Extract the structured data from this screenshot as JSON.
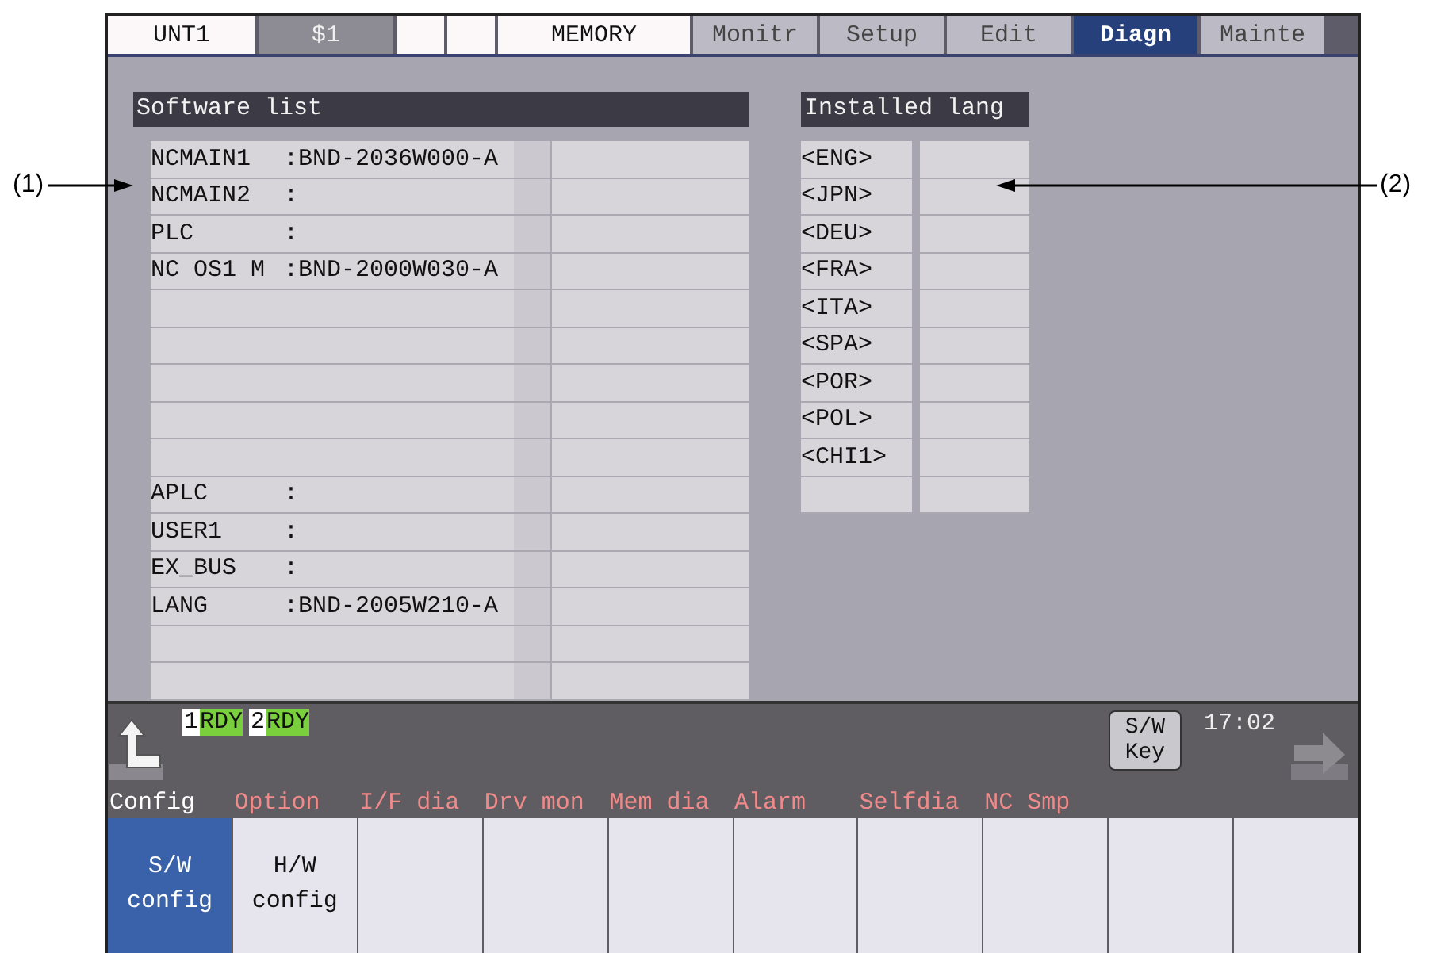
{
  "top_bar": {
    "fields": [
      {
        "kind": "unit",
        "label": "UNT1"
      },
      {
        "kind": "system",
        "label": "$1"
      },
      {
        "kind": "blank"
      },
      {
        "kind": "blank"
      },
      {
        "kind": "mode",
        "label": "MEMORY"
      }
    ],
    "tabs": [
      {
        "label": "Monitr",
        "selected": false
      },
      {
        "label": "Setup",
        "selected": false
      },
      {
        "label": "Edit",
        "selected": false
      },
      {
        "label": "Diagn",
        "selected": true
      },
      {
        "label": "Mainte",
        "selected": false
      }
    ]
  },
  "software_list": {
    "title": "Software list",
    "rows": [
      {
        "name": "NCMAIN1",
        "value": ":BND-2036W000-A"
      },
      {
        "name": "NCMAIN2",
        "value": ":"
      },
      {
        "name": "PLC",
        "value": ":"
      },
      {
        "name": "NC OS1 M",
        "value": ":BND-2000W030-A"
      },
      {},
      {},
      {},
      {},
      {},
      {
        "name": "APLC",
        "value": ":"
      },
      {
        "name": "USER1",
        "value": ":"
      },
      {
        "name": "EX_BUS",
        "value": ":"
      },
      {
        "name": "LANG",
        "value": ":BND-2005W210-A"
      },
      {},
      {}
    ]
  },
  "installed_lang": {
    "title": "Installed lang",
    "rows": [
      {
        "code": "<ENG>"
      },
      {
        "code": "<JPN>"
      },
      {
        "code": "<DEU>"
      },
      {
        "code": "<FRA>"
      },
      {
        "code": "<ITA>"
      },
      {
        "code": "<SPA>"
      },
      {
        "code": "<POR>"
      },
      {
        "code": "<POL>"
      },
      {
        "code": "<CHI1>"
      },
      {}
    ]
  },
  "status_bar": {
    "badges": [
      {
        "number": "1",
        "state": "RDY"
      },
      {
        "number": "2",
        "state": "RDY"
      }
    ],
    "key_button": "S/W Key",
    "time": "17:02"
  },
  "menu": [
    {
      "label": "Config",
      "selected": true
    },
    {
      "label": "Option",
      "selected": false
    },
    {
      "label": "I/F dia",
      "selected": false
    },
    {
      "label": "Drv mon",
      "selected": false
    },
    {
      "label": "Mem dia",
      "selected": false
    },
    {
      "label": "Alarm",
      "selected": false
    },
    {
      "label": "Selfdia",
      "selected": false
    },
    {
      "label": "NC Smp",
      "selected": false
    }
  ],
  "softkeys": [
    {
      "label": "S/W config",
      "selected": true
    },
    {
      "label": "H/W config",
      "selected": false
    }
  ],
  "callouts": [
    {
      "label": "(1)"
    },
    {
      "label": "(2)"
    }
  ]
}
